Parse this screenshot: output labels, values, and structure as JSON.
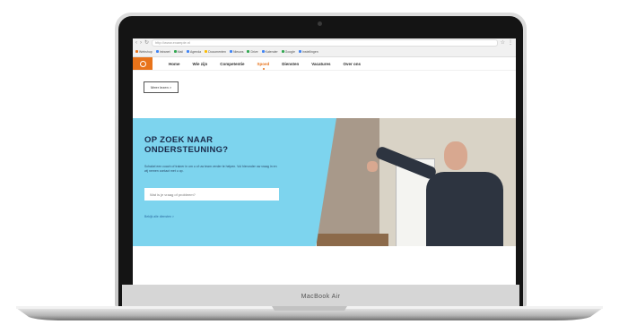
{
  "device": {
    "brand": "MacBook Air"
  },
  "browser": {
    "address": "http://www.example.nl",
    "bookmarks": [
      "Webshop",
      "Intranet",
      "Mail",
      "Agenda",
      "Documenten",
      "Nieuws",
      "Drive",
      "Kalender",
      "Google",
      "Instellingen"
    ]
  },
  "site": {
    "nav": [
      "Home",
      "Wie zijn",
      "Competentie",
      "Spoed",
      "Diensten",
      "Vacatures",
      "Over ons"
    ],
    "active_nav": "Spoed",
    "more_button": "Meer lezen >",
    "hero": {
      "title": "OP ZOEK NAAR ONDERSTEUNING?",
      "text": "Schakel een coach of trainer in om u of uw team verder te helpen. Vul hieronder uw vraag in en wij nemen contact met u op.",
      "input_placeholder": "Wat is je vraag of probleem?",
      "link": "Bekijk alle diensten >"
    }
  }
}
